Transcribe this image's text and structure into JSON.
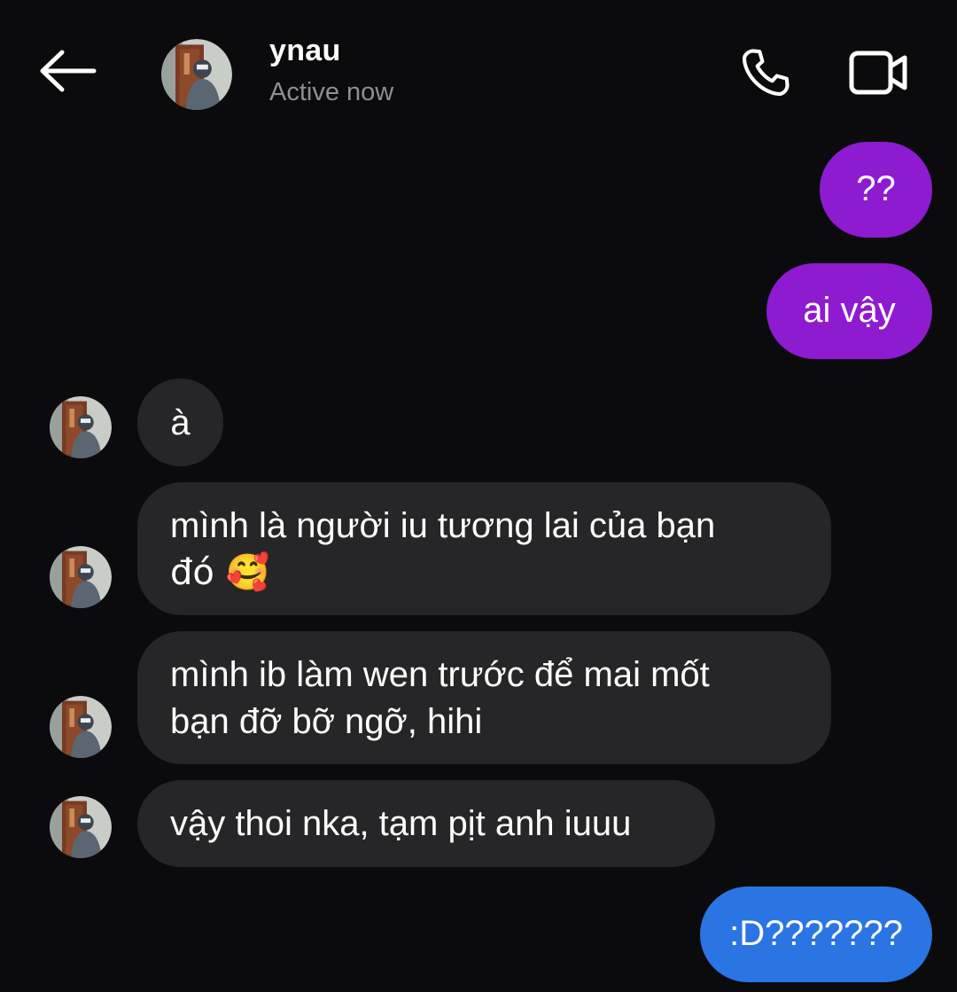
{
  "header": {
    "contact_name": "ynau",
    "status": "Active now",
    "icons": {
      "back": "arrow-left-icon",
      "call": "phone-icon",
      "video": "video-camera-icon"
    }
  },
  "messages": [
    {
      "direction": "outgoing",
      "color": "#8e1bd0",
      "lines": [
        "??"
      ]
    },
    {
      "direction": "outgoing",
      "color": "#8e1bd0",
      "lines": [
        "ai vậy"
      ]
    },
    {
      "direction": "incoming",
      "color": "#262628",
      "lines": [
        "à"
      ]
    },
    {
      "direction": "incoming",
      "color": "#262628",
      "lines": [
        "mình là người iu tương lai của bạn",
        "đó 🥰"
      ]
    },
    {
      "direction": "incoming",
      "color": "#262628",
      "lines": [
        "mình ib làm wen trước để mai mốt",
        "bạn đỡ bỡ ngỡ, hihi"
      ]
    },
    {
      "direction": "incoming",
      "color": "#262628",
      "lines": [
        "vậy thoi nka, tạm pịt anh iuuu"
      ]
    },
    {
      "direction": "outgoing",
      "color": "#2a74e3",
      "lines": [
        ":D???????"
      ]
    }
  ],
  "colors": {
    "background": "#0b0b0d",
    "outgoing_purple": "#8e1bd0",
    "outgoing_blue": "#2a74e3",
    "incoming": "#262628",
    "status_text": "#8e8e93"
  }
}
